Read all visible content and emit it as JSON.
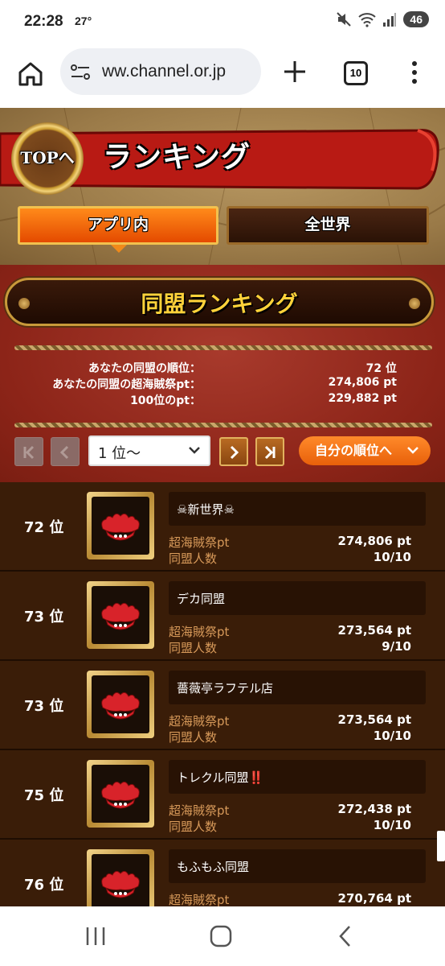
{
  "status": {
    "time": "22:28",
    "temperature": "27°",
    "battery": "46"
  },
  "browser": {
    "url": "ww.channel.or.jp",
    "tab_count": "10"
  },
  "header": {
    "top_button": "TOPへ",
    "title": "ランキング"
  },
  "tabs": [
    {
      "label": "アプリ内",
      "active": true
    },
    {
      "label": "全世界",
      "active": false
    }
  ],
  "section_title": "同盟ランキング",
  "stats": [
    {
      "label": "あなたの同盟の順位：",
      "value": "72 位"
    },
    {
      "label": "あなたの同盟の超海賊祭pt：",
      "value": "274,806 pt"
    },
    {
      "label": "100位のpt：",
      "value": "229,882 pt"
    }
  ],
  "pager": {
    "first": "K",
    "prev": "<",
    "selected": "1 位〜",
    "next": ">",
    "last": ">|",
    "my_rank": "自分の順位へ"
  },
  "row_labels": {
    "points": "超海賊祭pt",
    "members": "同盟人数"
  },
  "rankings": [
    {
      "rank": "72 位",
      "name": "☠新世界☠",
      "points": "274,806 pt",
      "members": "10/10"
    },
    {
      "rank": "73 位",
      "name": "デカ同盟",
      "points": "273,564 pt",
      "members": "9/10"
    },
    {
      "rank": "73 位",
      "name": "薔薇亭ラフテル店",
      "points": "273,564 pt",
      "members": "10/10"
    },
    {
      "rank": "75 位",
      "name": "トレクル同盟‼️",
      "points": "272,438 pt",
      "members": "10/10"
    },
    {
      "rank": "76 位",
      "name": "もふもふ同盟",
      "points": "270,764 pt",
      "members": ""
    }
  ],
  "colors": {
    "accent_orange": "#e8600a",
    "panel_red": "#8c2418",
    "list_brown": "#3a1d08",
    "label_tan": "#d89a5a"
  }
}
